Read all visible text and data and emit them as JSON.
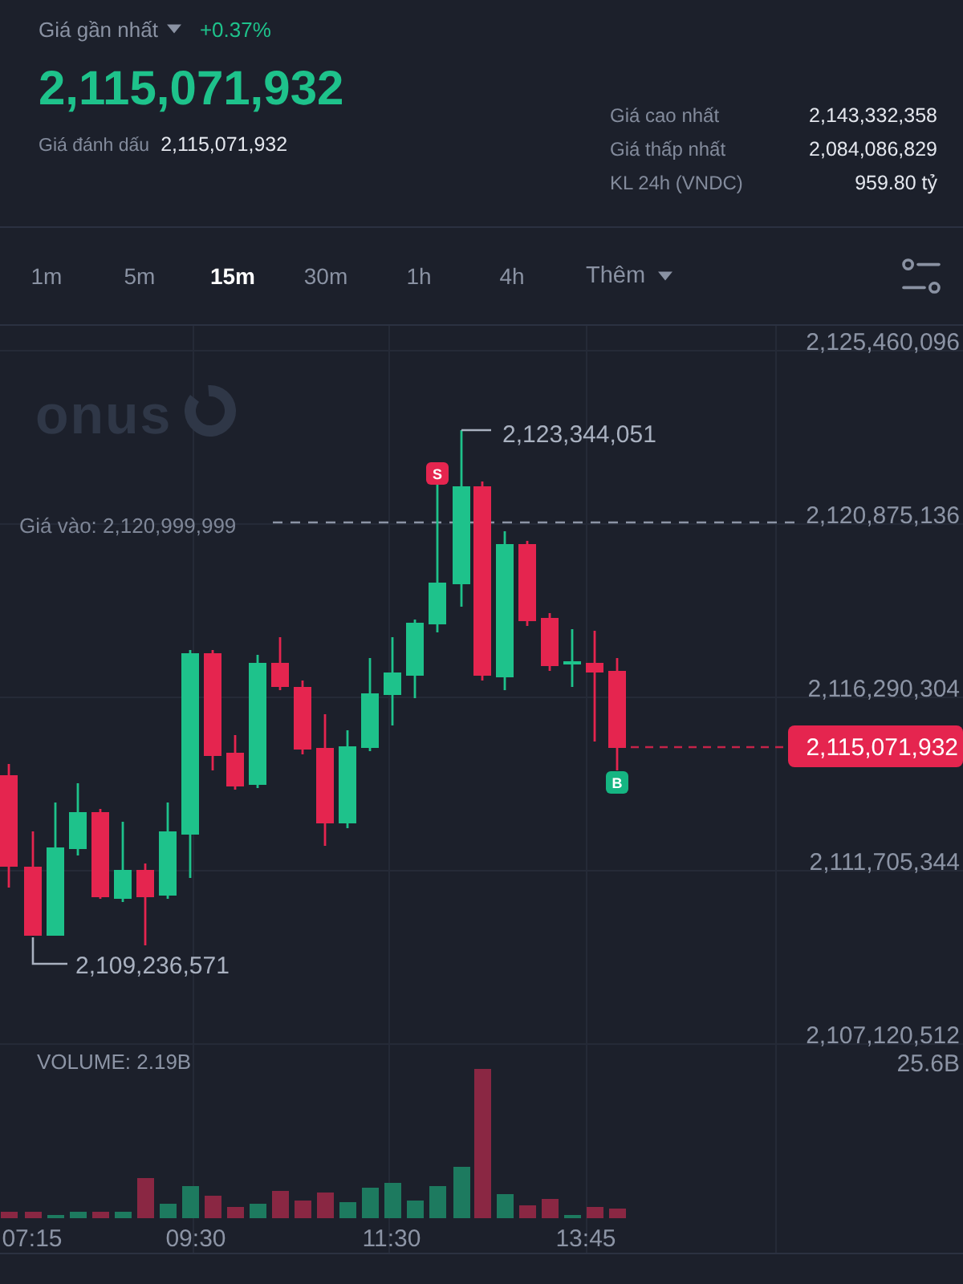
{
  "header": {
    "last_price_label": "Giá gần nhất",
    "change": "+0.37%",
    "last_price": "2,115,071,932",
    "mark_price_label": "Giá đánh dấu",
    "mark_price": "2,115,071,932"
  },
  "stats": [
    {
      "label": "Giá cao nhất",
      "value": "2,143,332,358"
    },
    {
      "label": "Giá thấp nhất",
      "value": "2,084,086,829"
    },
    {
      "label": "KL 24h (VNDC)",
      "value": "959.80 tỷ"
    }
  ],
  "intervals": [
    {
      "label": "1m",
      "selected": false
    },
    {
      "label": "5m",
      "selected": false
    },
    {
      "label": "15m",
      "selected": true
    },
    {
      "label": "30m",
      "selected": false
    },
    {
      "label": "1h",
      "selected": false
    },
    {
      "label": "4h",
      "selected": false
    }
  ],
  "more_menu": {
    "label": "Thêm"
  },
  "chart": {
    "watermark": "onus",
    "price_axis": [
      "2,125,460,096",
      "2,120,875,136",
      "2,116,290,304",
      "2,111,705,344",
      "2,107,120,512"
    ],
    "entry_line": {
      "label": "Giá vào: 2,120,999,999"
    },
    "high_label": "2,123,344,051",
    "low_label": "2,109,236,571",
    "current_price": "2,115,071,932",
    "markers": [
      {
        "kind": "sell",
        "letter": "S"
      },
      {
        "kind": "buy",
        "letter": "B"
      }
    ],
    "volume_label": "VOLUME: 2.19B",
    "volume_axis": "25.6B",
    "time_axis": [
      "07:15",
      "09:30",
      "11:30",
      "13:45"
    ]
  }
}
